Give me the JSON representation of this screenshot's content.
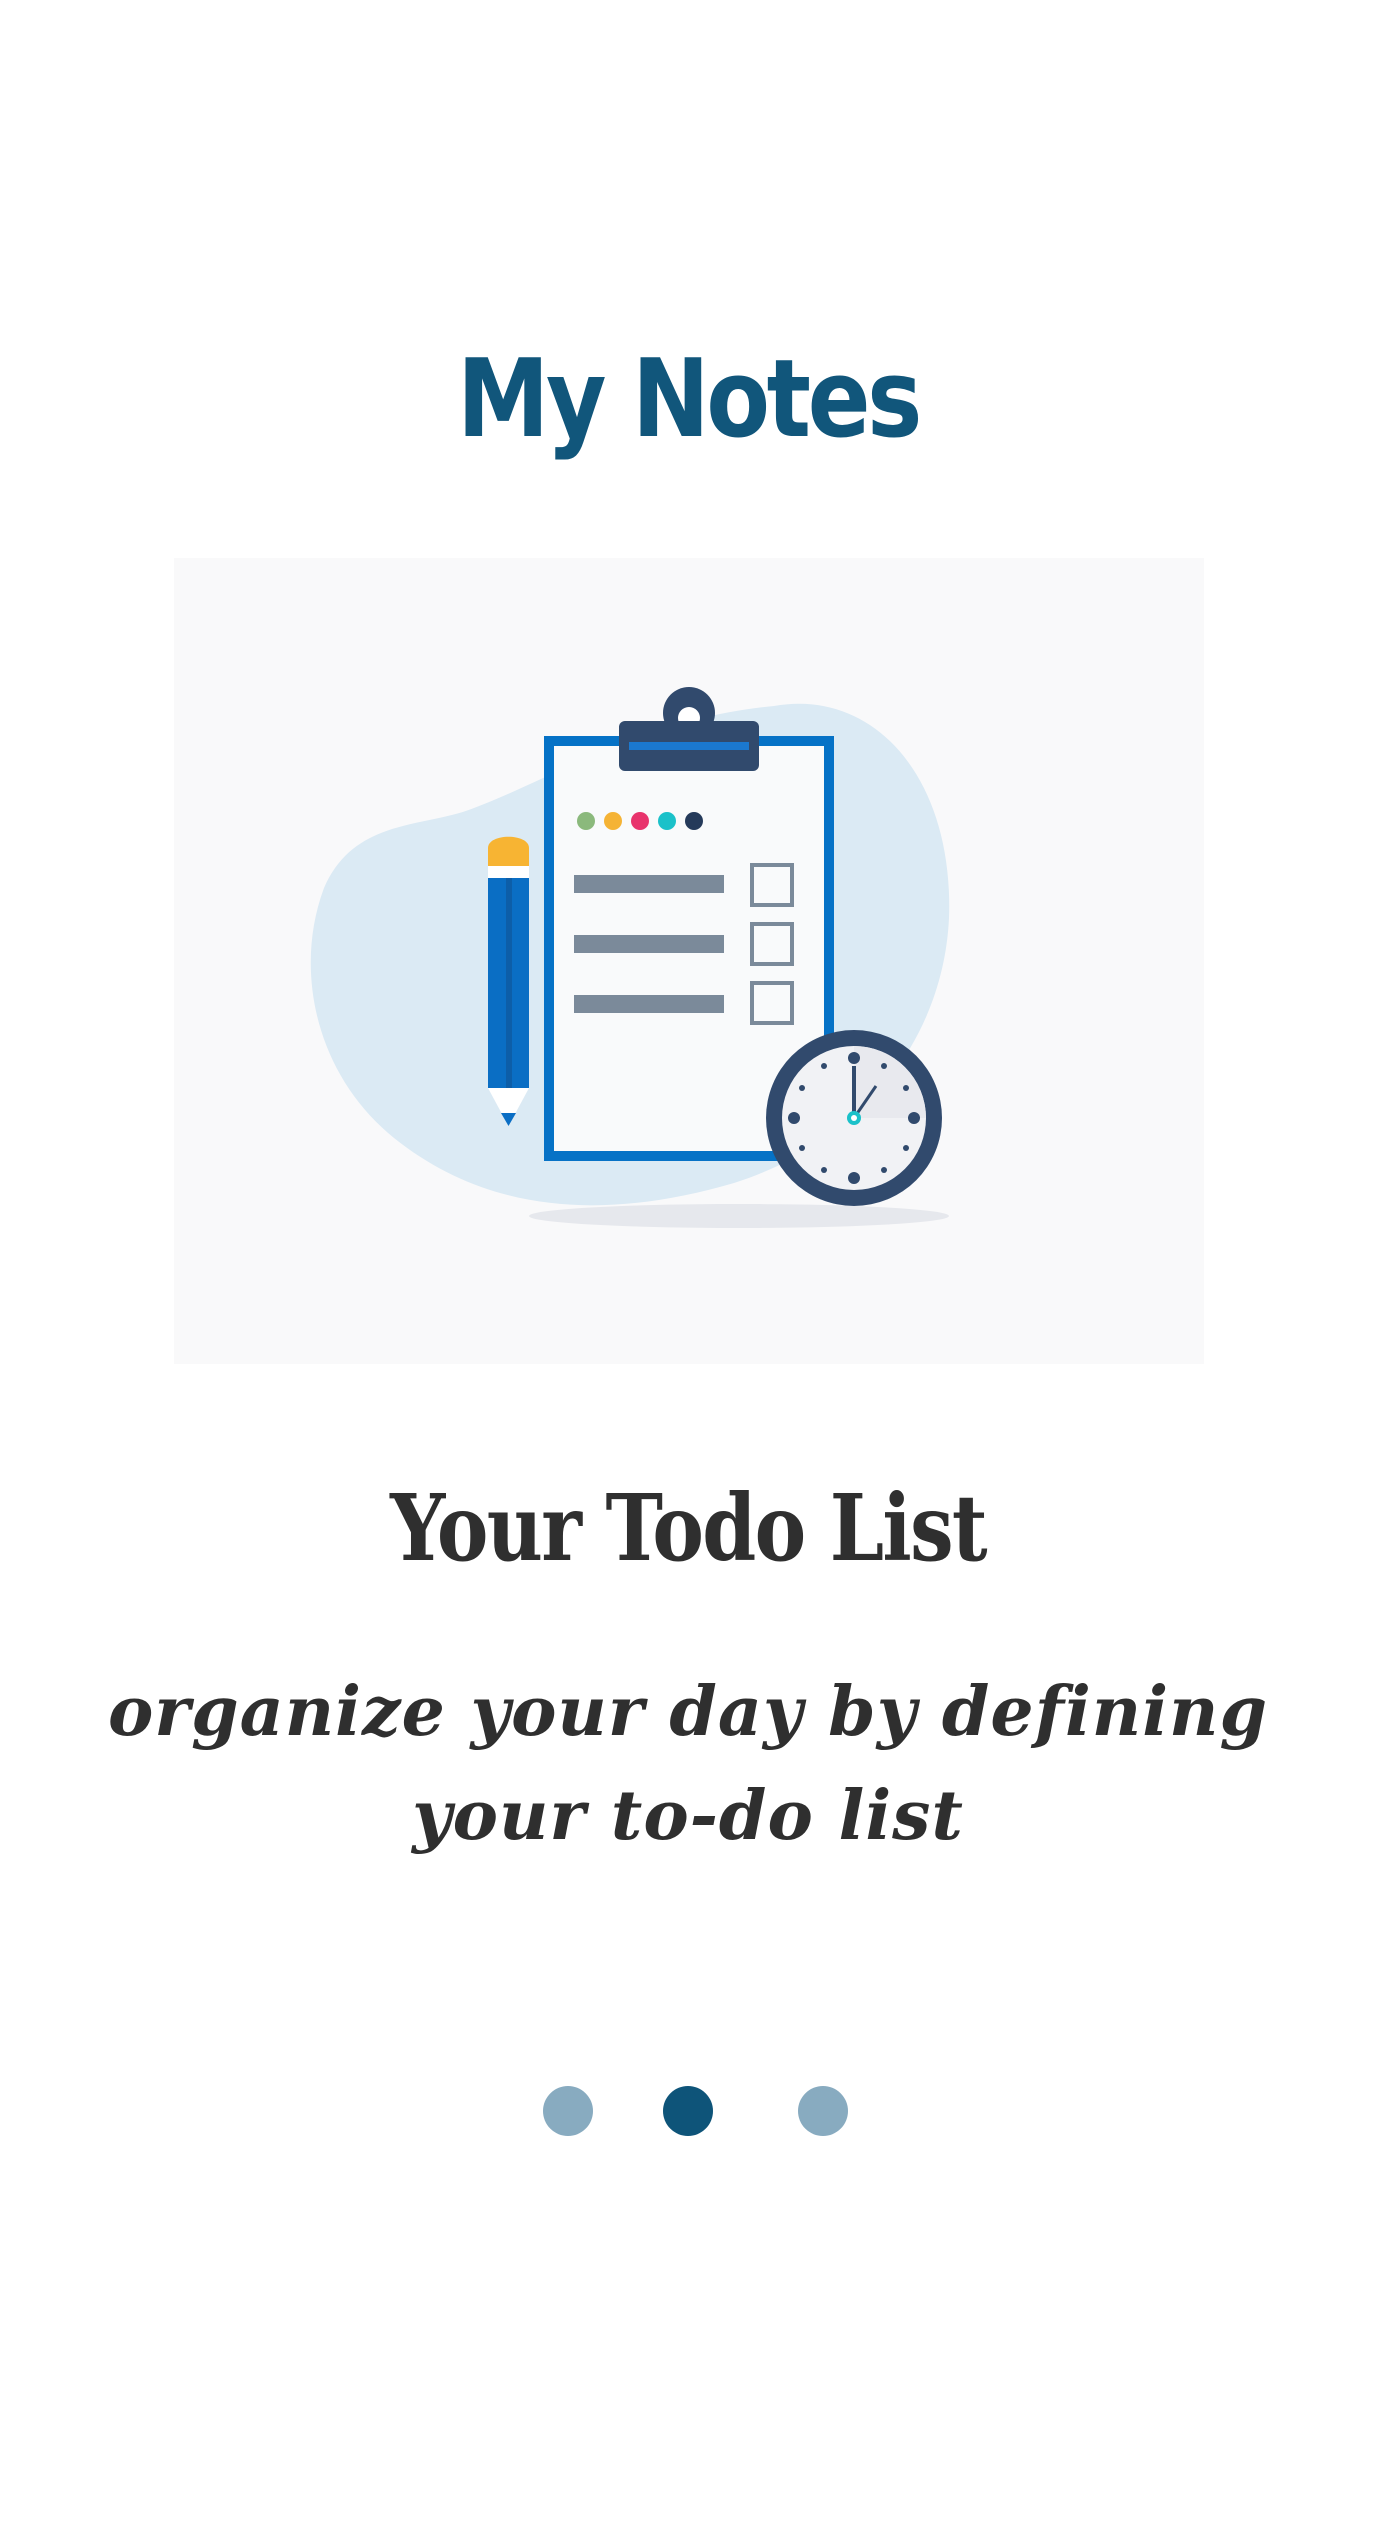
{
  "app": {
    "title": "My Notes"
  },
  "slide": {
    "title": "Your Todo List",
    "description_line1": "organize your day by defining",
    "description_line2": "your to-do list",
    "illustration": "clipboard-checklist-with-pencil-and-clock"
  },
  "pager": {
    "dots": [
      {
        "name": "page-dot-1",
        "active": false
      },
      {
        "name": "page-dot-2",
        "active": true
      },
      {
        "name": "page-dot-3",
        "active": false
      }
    ],
    "active_index": 2,
    "total": 3
  },
  "colors": {
    "brand": "#11567b",
    "text": "#2f2f2f",
    "dot_active": "#0e5479",
    "dot_inactive": "#88abc0",
    "illustration_bg": "#f9f9fa"
  }
}
